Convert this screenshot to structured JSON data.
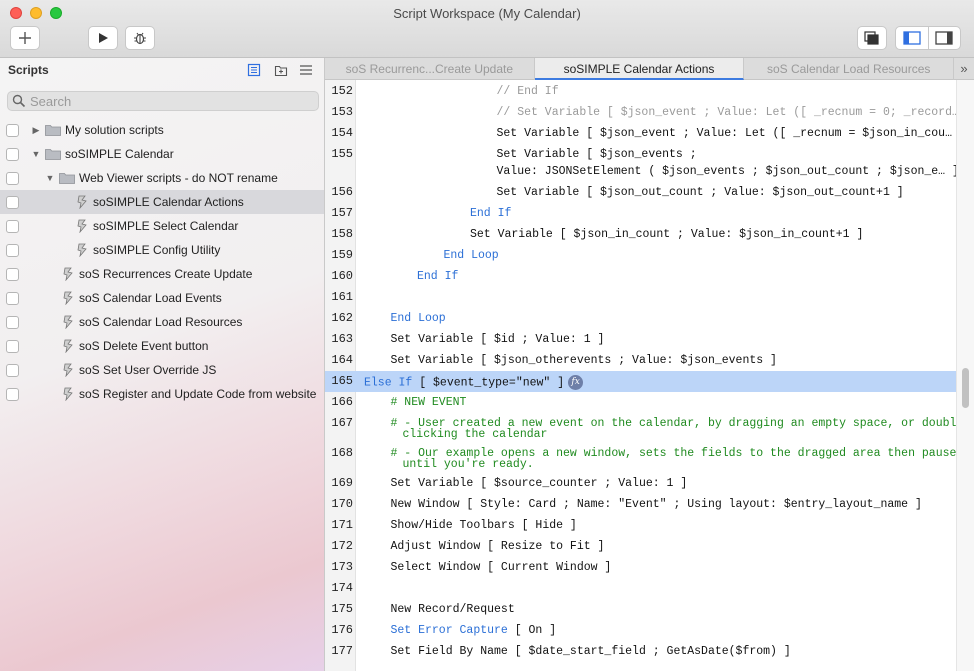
{
  "window": {
    "title": "Script Workspace (My Calendar)"
  },
  "toolbar": {
    "add_icon": "plus-icon",
    "run_icon": "play-icon",
    "debug_icon": "bug-icon",
    "windows_icon": "windows-icon",
    "left_panel_icon": "sidebar-left-icon",
    "right_panel_icon": "sidebar-right-icon"
  },
  "sidebar": {
    "title": "Scripts",
    "search_placeholder": "Search",
    "items": [
      {
        "label": "My solution scripts",
        "type": "folder",
        "indent": 0,
        "state": "collapsed"
      },
      {
        "label": "soSIMPLE Calendar",
        "type": "folder",
        "indent": 0,
        "state": "expanded"
      },
      {
        "label": "Web Viewer scripts - do NOT rename",
        "type": "folder",
        "indent": 1,
        "state": "expanded"
      },
      {
        "label": "soSIMPLE Calendar Actions",
        "type": "script",
        "indent": 2,
        "selected": true
      },
      {
        "label": "soSIMPLE Select Calendar",
        "type": "script",
        "indent": 2
      },
      {
        "label": "soSIMPLE Config Utility",
        "type": "script",
        "indent": 2
      },
      {
        "label": "soS Recurrences Create Update",
        "type": "script",
        "indent": 1
      },
      {
        "label": "soS Calendar Load Events",
        "type": "script",
        "indent": 1
      },
      {
        "label": "soS Calendar Load Resources",
        "type": "script",
        "indent": 1
      },
      {
        "label": "soS Delete Event button",
        "type": "script",
        "indent": 1
      },
      {
        "label": "soS Set User Override JS",
        "type": "script",
        "indent": 1
      },
      {
        "label": "soS Register and Update Code from website",
        "type": "script",
        "indent": 1
      }
    ]
  },
  "tabs": [
    {
      "label": "soS Recurrenc...Create Update",
      "active": false
    },
    {
      "label": "soSIMPLE Calendar Actions",
      "active": true
    },
    {
      "label": "soS Calendar Load Resources",
      "active": false
    }
  ],
  "tabs_overflow": "»",
  "editor": {
    "lines": [
      {
        "n": "152",
        "indent": 5,
        "parts": [
          {
            "t": "// End If",
            "c": "cm"
          }
        ]
      },
      {
        "n": "153",
        "indent": 5,
        "parts": [
          {
            "t": "// Set Variable [ $json_event ; Value: Let ([ _recnum = 0; _record… ]",
            "c": "cm"
          }
        ]
      },
      {
        "n": "154",
        "indent": 5,
        "parts": [
          {
            "t": "Set Variable [ $json_event ; Value: Let ([ _recnum = $json_in_cou… ]",
            "c": ""
          }
        ]
      },
      {
        "n": "155",
        "indent": 5,
        "parts": [
          {
            "t": "Set Variable [ $json_events ;",
            "c": ""
          }
        ],
        "cont": "Value: JSONSetElement ( $json_events ; $json_out_count ; $json_e… ]"
      },
      {
        "n": "156",
        "indent": 5,
        "parts": [
          {
            "t": "Set Variable [ $json_out_count ; Value: $json_out_count+1 ]",
            "c": ""
          }
        ]
      },
      {
        "n": "157",
        "indent": 4,
        "parts": [
          {
            "t": "End If",
            "c": "kw"
          }
        ]
      },
      {
        "n": "158",
        "indent": 4,
        "parts": [
          {
            "t": "Set Variable [ $json_in_count ; Value: $json_in_count+1 ]",
            "c": ""
          }
        ]
      },
      {
        "n": "159",
        "indent": 3,
        "parts": [
          {
            "t": "End Loop",
            "c": "kw"
          }
        ]
      },
      {
        "n": "160",
        "indent": 2,
        "parts": [
          {
            "t": "End If",
            "c": "kw"
          }
        ]
      },
      {
        "n": "161",
        "indent": 0,
        "parts": [
          {
            "t": "",
            "c": ""
          }
        ]
      },
      {
        "n": "162",
        "indent": 1,
        "parts": [
          {
            "t": "End Loop",
            "c": "kw"
          }
        ]
      },
      {
        "n": "163",
        "indent": 1,
        "parts": [
          {
            "t": "Set Variable [ $id ; Value: 1 ]",
            "c": ""
          }
        ]
      },
      {
        "n": "164",
        "indent": 1,
        "parts": [
          {
            "t": "Set Variable [ $json_otherevents ; Value: $json_events ]",
            "c": ""
          }
        ]
      },
      {
        "n": "165",
        "indent": 0,
        "highlight": true,
        "fx": true,
        "parts": [
          {
            "t": "Else If",
            "c": "kw"
          },
          {
            "t": " [ $event_type=\"new\" ]",
            "c": ""
          }
        ]
      },
      {
        "n": "166",
        "indent": 1,
        "parts": [
          {
            "t": "# NEW EVENT",
            "c": "gr"
          }
        ]
      },
      {
        "n": "167",
        "indent": 1,
        "parts": [
          {
            "t": "# - User created a new event on the calendar, by dragging an empty space, or double-",
            "c": "gr"
          }
        ],
        "cont": "clicking the calendar",
        "cont_class": "gr"
      },
      {
        "n": "168",
        "indent": 1,
        "parts": [
          {
            "t": "# - Our example opens a new window, sets the fields to the dragged area then pauses",
            "c": "gr"
          }
        ],
        "cont": "until you're ready.",
        "cont_class": "gr"
      },
      {
        "n": "169",
        "indent": 1,
        "parts": [
          {
            "t": "Set Variable [ $source_counter ; Value: 1 ]",
            "c": ""
          }
        ]
      },
      {
        "n": "170",
        "indent": 1,
        "parts": [
          {
            "t": "New Window [ Style: Card ; Name: \"Event\" ; Using layout: $entry_layout_name ]",
            "c": ""
          }
        ]
      },
      {
        "n": "171",
        "indent": 1,
        "parts": [
          {
            "t": "Show/Hide Toolbars [ Hide ]",
            "c": ""
          }
        ]
      },
      {
        "n": "172",
        "indent": 1,
        "parts": [
          {
            "t": "Adjust Window [ Resize to Fit ]",
            "c": ""
          }
        ]
      },
      {
        "n": "173",
        "indent": 1,
        "parts": [
          {
            "t": "Select Window [ Current Window ]",
            "c": ""
          }
        ]
      },
      {
        "n": "174",
        "indent": 0,
        "parts": [
          {
            "t": "",
            "c": ""
          }
        ]
      },
      {
        "n": "175",
        "indent": 1,
        "parts": [
          {
            "t": "New Record/Request",
            "c": ""
          }
        ]
      },
      {
        "n": "176",
        "indent": 1,
        "parts": [
          {
            "t": "Set Error Capture",
            "c": "kw"
          },
          {
            "t": " [ On ]",
            "c": ""
          }
        ]
      },
      {
        "n": "177",
        "indent": 1,
        "parts": [
          {
            "t": "Set Field By Name [ $date_start_field ; GetAsDate($from) ]",
            "c": ""
          }
        ]
      }
    ]
  }
}
